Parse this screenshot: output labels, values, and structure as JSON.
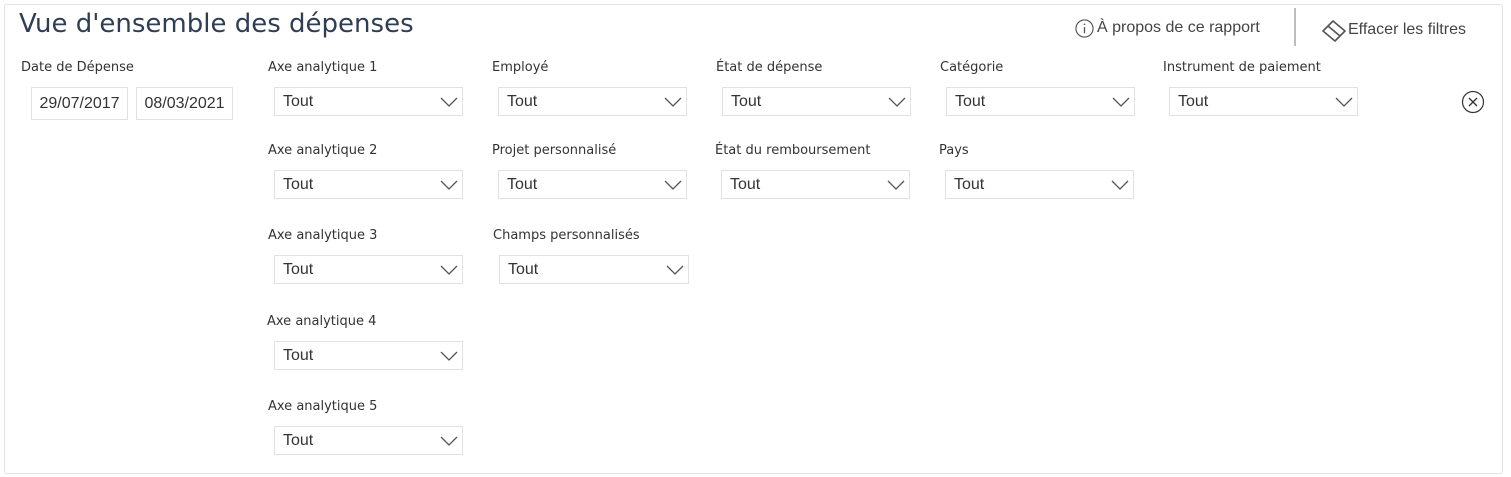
{
  "header": {
    "title": "Vue d'ensemble des dépenses",
    "about_label": "À propos de ce rapport",
    "clear_filters_label": "Effacer les filtres"
  },
  "date_filter": {
    "label": "Date de Dépense",
    "start": "29/07/2017",
    "end": "08/03/2021"
  },
  "filters": {
    "axe1": {
      "label": "Axe analytique 1",
      "value": "Tout"
    },
    "employe": {
      "label": "Employé",
      "value": "Tout"
    },
    "etat_depense": {
      "label": "État de dépense",
      "value": "Tout"
    },
    "categorie": {
      "label": "Catégorie",
      "value": "Tout"
    },
    "instrument": {
      "label": "Instrument de paiement",
      "value": "Tout"
    },
    "axe2": {
      "label": "Axe analytique 2",
      "value": "Tout"
    },
    "projet": {
      "label": "Projet personnalisé",
      "value": "Tout"
    },
    "etat_remb": {
      "label": "État du remboursement",
      "value": "Tout"
    },
    "pays": {
      "label": "Pays",
      "value": "Tout"
    },
    "axe3": {
      "label": "Axe analytique 3",
      "value": "Tout"
    },
    "champs": {
      "label": "Champs personnalisés",
      "value": "Tout"
    },
    "axe4": {
      "label": "Axe analytique 4",
      "value": "Tout"
    },
    "axe5": {
      "label": "Axe analytique 5",
      "value": "Tout"
    }
  },
  "icons": {
    "info": "info-circle-icon",
    "clear": "eraser-icon",
    "dropdown": "chevron-down-icon",
    "close": "close-circle-icon"
  }
}
